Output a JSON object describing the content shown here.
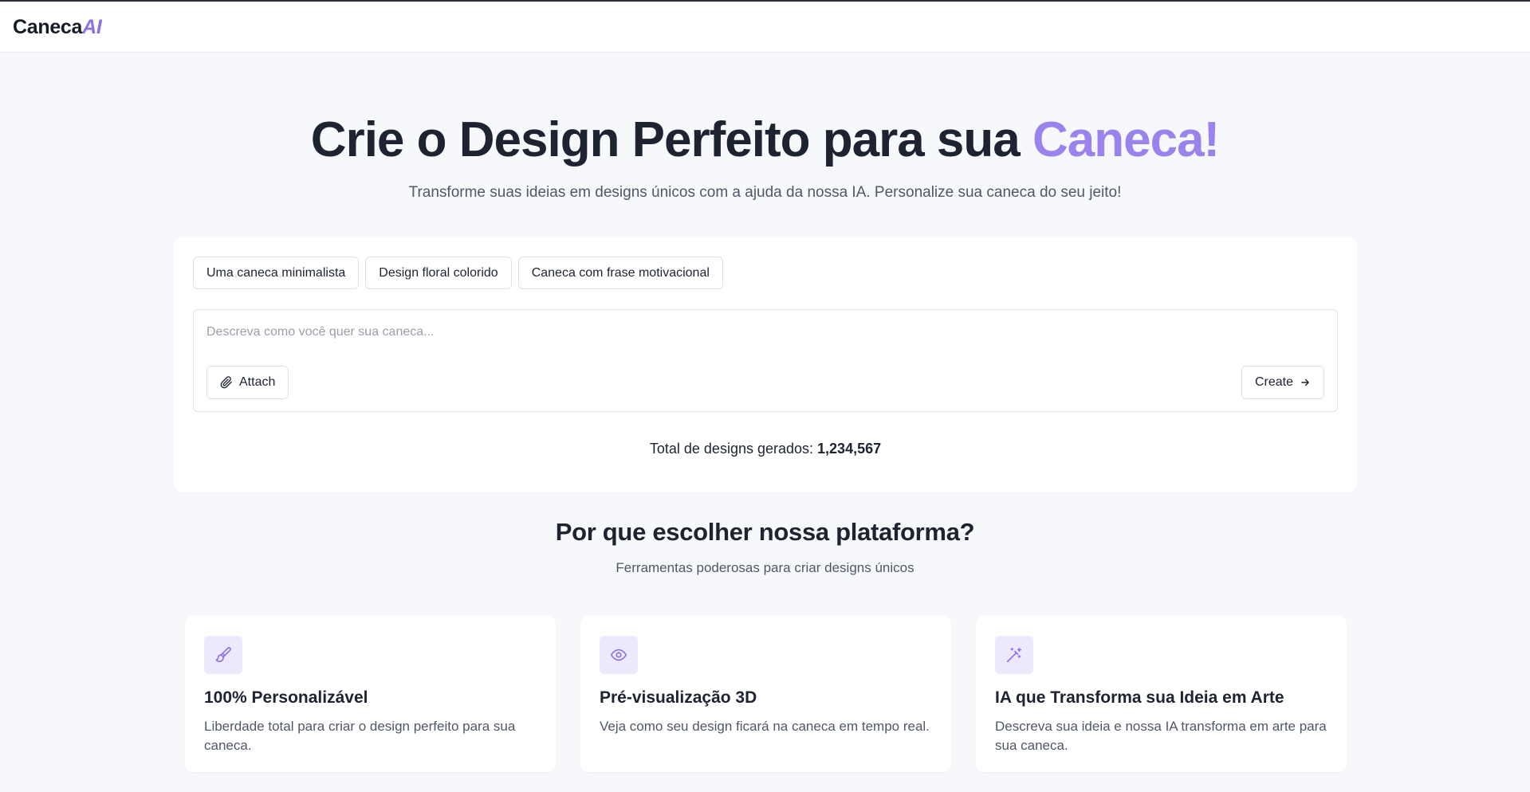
{
  "header": {
    "brand_main": "Caneca",
    "brand_accent": "AI"
  },
  "hero": {
    "title_main": "Crie o Design Perfeito para sua ",
    "title_accent": "Caneca!",
    "subtitle": "Transforme suas ideias em designs únicos com a ajuda da nossa IA. Personalize sua caneca do seu jeito!"
  },
  "suggestions": [
    "Uma caneca minimalista",
    "Design floral colorido",
    "Caneca com frase motivacional"
  ],
  "prompt": {
    "placeholder": "Descreva como você quer sua caneca...",
    "value": "",
    "attach_label": "Attach",
    "create_label": "Create"
  },
  "stats": {
    "label": "Total de designs gerados:",
    "value": "1,234,567"
  },
  "why": {
    "title": "Por que escolher nossa plataforma?",
    "subtitle": "Ferramentas poderosas para criar designs únicos"
  },
  "features": [
    {
      "icon": "paintbrush-icon",
      "title": "100% Personalizável",
      "description": "Liberdade total para criar o design perfeito para sua caneca."
    },
    {
      "icon": "eye-icon",
      "title": "Pré-visualização 3D",
      "description": "Veja como seu design ficará na caneca em tempo real."
    },
    {
      "icon": "magic-wand-icon",
      "title": "IA que Transforma sua Ideia em Arte",
      "description": "Descreva sua ideia e nossa IA transforma em arte para sua caneca."
    }
  ],
  "colors": {
    "accent": "#9a83ec",
    "icon_bg": "#ede8fc",
    "page_bg": "#f7f8fb",
    "text": "#1d2331"
  }
}
